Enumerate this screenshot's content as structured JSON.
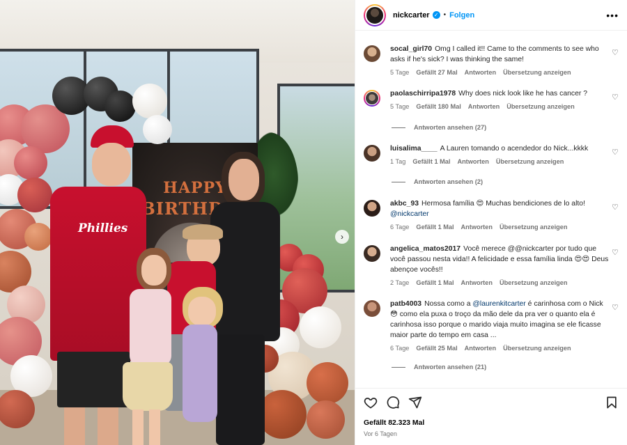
{
  "post": {
    "username": "nickcarter",
    "verified_icon": "verified-badge-icon",
    "separator": "•",
    "follow_label": "Folgen",
    "more_label": "•••",
    "photo": {
      "backdrop_line1": "HAPPY",
      "backdrop_line2": "BIRTHDAY",
      "jersey_text": "Phillies",
      "next_arrow": "›"
    }
  },
  "comments": [
    {
      "user": "socal_girl70",
      "text": "Omg I called it!! Came to the comments to see who asks if he's sick? I was thinking the same!",
      "time": "5 Tage",
      "likes": "Gefällt 27 Mal",
      "reply": "Antworten",
      "translate": "Übersetzung anzeigen"
    },
    {
      "user": "paolaschirripa1978",
      "text": "Why does nick look like he has cancer ?",
      "time": "5 Tage",
      "likes": "Gefällt 180 Mal",
      "reply": "Antworten",
      "translate": "Übersetzung anzeigen",
      "view_replies": "Antworten ansehen (27)"
    },
    {
      "user": "luisalima____",
      "text": "A Lauren tomando o acendedor do Nick...kkkk",
      "time": "1 Tag",
      "likes": "Gefällt 1 Mal",
      "reply": "Antworten",
      "translate": "Übersetzung anzeigen",
      "view_replies": "Antworten ansehen (2)"
    },
    {
      "user": "akbc_93",
      "text": "Hermosa família 😍 Muchas bendiciones de lo alto!",
      "mention": "@nickcarter",
      "time": "6 Tage",
      "likes": "Gefällt 1 Mal",
      "reply": "Antworten",
      "translate": "Übersetzung anzeigen"
    },
    {
      "user": "angelica_matos2017",
      "text": "Você merece @@nickcarter por tudo que você passou nesta vida!! A felicidade e essa família linda 😍😍 Deus abençoe vocês!!",
      "time": "2 Tage",
      "likes": "Gefällt 1 Mal",
      "reply": "Antworten",
      "translate": "Übersetzung anzeigen"
    },
    {
      "user": "patb4003",
      "text_a": "Nossa como a",
      "mention": "@laurenkitcarter",
      "text_b": "é carinhosa com o Nick 😳 como ela puxa o troço da mão dele da pra ver o quanto ela é carinhosa isso porque o marido viaja muito imagina se ele ficasse maior parte do tempo em casa ...",
      "time": "6 Tage",
      "likes": "Gefällt 25 Mal",
      "reply": "Antworten",
      "translate": "Übersetzung anzeigen",
      "view_replies": "Antworten ansehen (21)"
    }
  ],
  "footer": {
    "likes": "Gefällt 82.323 Mal",
    "posted": "Vor 6 Tagen",
    "icons": [
      "heart-icon",
      "comment-icon",
      "share-icon",
      "bookmark-icon"
    ]
  },
  "colors": {
    "link": "#00376b",
    "follow": "#0095f6",
    "meta": "#737373",
    "jersey": "#c8102e"
  }
}
